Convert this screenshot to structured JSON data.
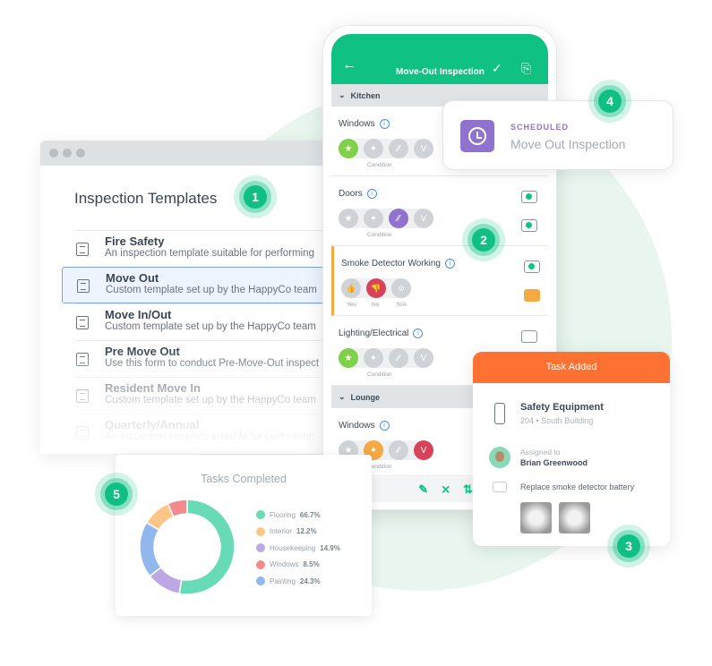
{
  "templates": {
    "title": "Inspection Templates",
    "items": [
      {
        "name": "Fire Safety",
        "desc": "An inspection template suitable for performing"
      },
      {
        "name": "Move Out",
        "desc": "Custom template set up by the HappyCo team",
        "selected": true
      },
      {
        "name": "Move In/Out",
        "desc": "Custom template set up by the HappyCo team"
      },
      {
        "name": "Pre Move Out",
        "desc": "Use this form to conduct Pre-Move-Out inspect"
      },
      {
        "name": "Resident Move In",
        "desc": "Custom template set up by the HappyCo team"
      },
      {
        "name": "Quarterly/Annual",
        "desc": "An inspection template suitable for performing"
      }
    ]
  },
  "phone": {
    "title": "Move-Out Inspection",
    "back_icon": "arrow-left-icon",
    "check_icon": "check-circle-icon",
    "new_icon": "file-plus-icon",
    "sections": [
      {
        "name": "Kitchen",
        "items": [
          {
            "label": "Windows",
            "type": "condition",
            "selected": 0,
            "caption": "Condition",
            "side": []
          },
          {
            "label": "Doors",
            "type": "condition",
            "selected": 2,
            "caption": "Condition",
            "side": [
              "camera",
              "comment-check"
            ]
          },
          {
            "label": "Smoke Detector Working",
            "type": "yesno",
            "selected": 1,
            "options": [
              "Yes",
              "No",
              "N/A"
            ],
            "flag": true,
            "side": [
              "camera",
              "comment"
            ]
          },
          {
            "label": "Lighting/Electrical",
            "type": "condition",
            "selected": 0,
            "caption": "Condition",
            "side": [
              "camera-empty"
            ]
          }
        ]
      },
      {
        "name": "Lounge",
        "items": [
          {
            "label": "Windows",
            "type": "condition",
            "selected": [
              1,
              3
            ],
            "caption": "Condition",
            "side": []
          }
        ]
      }
    ]
  },
  "scheduled": {
    "label": "SCHEDULED",
    "title": "Move Out Inspection"
  },
  "task": {
    "header": "Task Added",
    "equipment": "Safety Equipment",
    "location": "204 • South Building",
    "assigned_label": "Assigned to",
    "assignee": "Brian Greenwood",
    "note": "Replace smoke detector battery"
  },
  "badges": [
    "1",
    "2",
    "3",
    "4",
    "5"
  ],
  "colors": {
    "green": "#10c184",
    "purple": "#9072cf",
    "orange": "#fd7232",
    "red": "#d9435a",
    "lime": "#7fd14a",
    "amber": "#f5a942"
  },
  "chart_data": {
    "type": "pie",
    "title": "Tasks Completed",
    "donut": true,
    "series": [
      {
        "name": "Flooring",
        "value": 66.7,
        "color": "#66dbb5"
      },
      {
        "name": "Interior",
        "value": 12.2,
        "color": "#fdc686"
      },
      {
        "name": "Housekeeping",
        "value": 14.9,
        "color": "#bda8e6"
      },
      {
        "name": "Windows",
        "value": 8.5,
        "color": "#f38a8e"
      },
      {
        "name": "Painting",
        "value": 24.3,
        "color": "#90b8ee"
      }
    ]
  }
}
